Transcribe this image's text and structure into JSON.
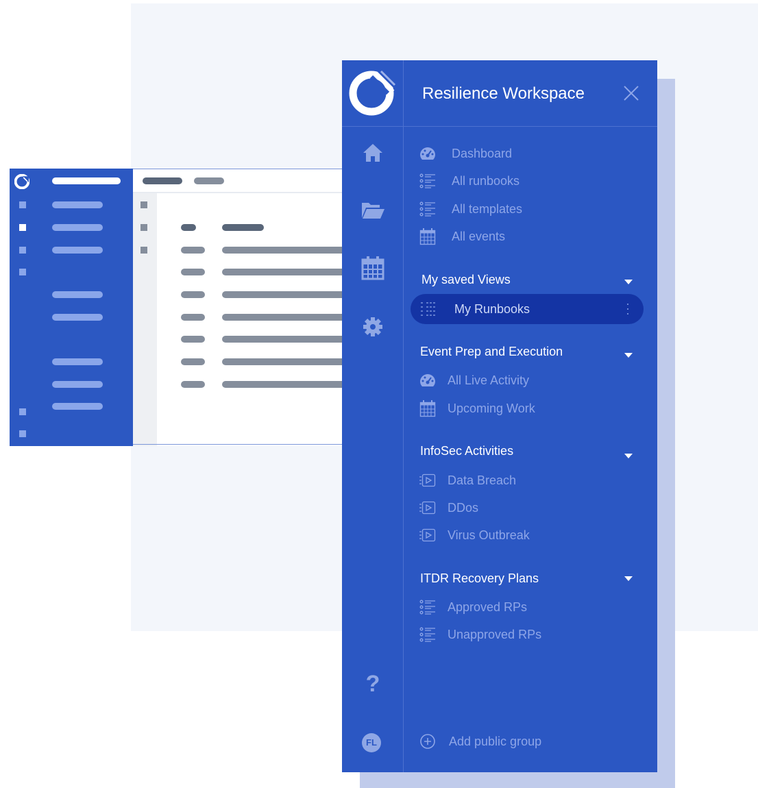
{
  "workspace": {
    "title": "Resilience Workspace"
  },
  "rail": {
    "help_label": "?",
    "avatar_initials": "FL"
  },
  "nav": {
    "top_items": [
      {
        "label": "Dashboard",
        "icon": "dashboard-gauge-icon"
      },
      {
        "label": "All runbooks",
        "icon": "list-icon"
      },
      {
        "label": "All templates",
        "icon": "list-icon"
      },
      {
        "label": "All events",
        "icon": "calendar-icon"
      }
    ],
    "saved_views": {
      "title": "My saved Views",
      "items": [
        {
          "label": "My Runbooks",
          "icon": "grid-list-icon",
          "selected": true
        }
      ]
    },
    "groups": [
      {
        "title": "Event Prep and Execution",
        "items": [
          {
            "label": "All Live Activity",
            "icon": "dashboard-gauge-icon"
          },
          {
            "label": "Upcoming Work",
            "icon": "calendar-icon"
          }
        ]
      },
      {
        "title": "InfoSec Activities",
        "items": [
          {
            "label": "Data Breach",
            "icon": "play-list-icon"
          },
          {
            "label": "DDos",
            "icon": "play-list-icon"
          },
          {
            "label": "Virus Outbreak",
            "icon": "play-list-icon"
          }
        ]
      },
      {
        "title": "ITDR Recovery Plans",
        "items": [
          {
            "label": "Approved RPs",
            "icon": "list-icon"
          },
          {
            "label": "Unapproved RPs",
            "icon": "list-icon"
          }
        ]
      }
    ],
    "add_group_label": "Add public group"
  },
  "colors": {
    "drawer": "#2b57c3",
    "selected": "#1434a4",
    "muted_text": "#8ea6e8",
    "shadow": "#c0cbeb",
    "backdrop": "#f3f6fb"
  }
}
